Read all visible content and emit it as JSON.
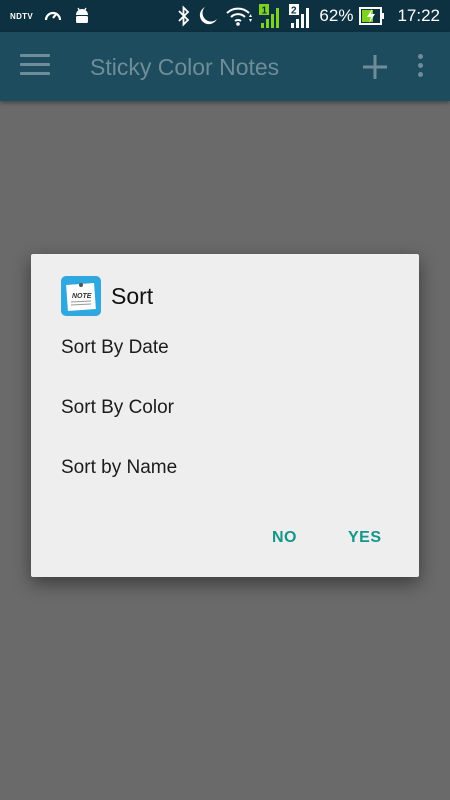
{
  "status_bar": {
    "left_icons": [
      "ndtv-icon",
      "speedometer-icon",
      "android-icon"
    ],
    "ndtv_label": "NDTV",
    "right_icons": [
      "bluetooth-icon",
      "moon-icon",
      "wifi-icon",
      "sim1-signal-icon",
      "sim2-signal-icon",
      "battery-charging-icon"
    ],
    "sim1_label": "1",
    "sim2_label": "2",
    "battery_percent": "62%",
    "time": "17:22"
  },
  "app_bar": {
    "title": "Sticky Color Notes",
    "icons": [
      "menu-icon",
      "add-icon",
      "more-vert-icon"
    ]
  },
  "dialog": {
    "icon": "notes-app-icon",
    "icon_label": "NOTE",
    "title": "Sort",
    "options": [
      "Sort By Date",
      "Sort By Color",
      "Sort by Name"
    ],
    "negative_button": "NO",
    "positive_button": "YES"
  },
  "colors": {
    "status_bar": "#0d3140",
    "app_bar_dimmed": "#1c4c5e",
    "scrim_background": "#6a6a6a",
    "dialog_background": "#eeeeee",
    "button_accent": "#159688",
    "battery_green": "#7ed321"
  }
}
